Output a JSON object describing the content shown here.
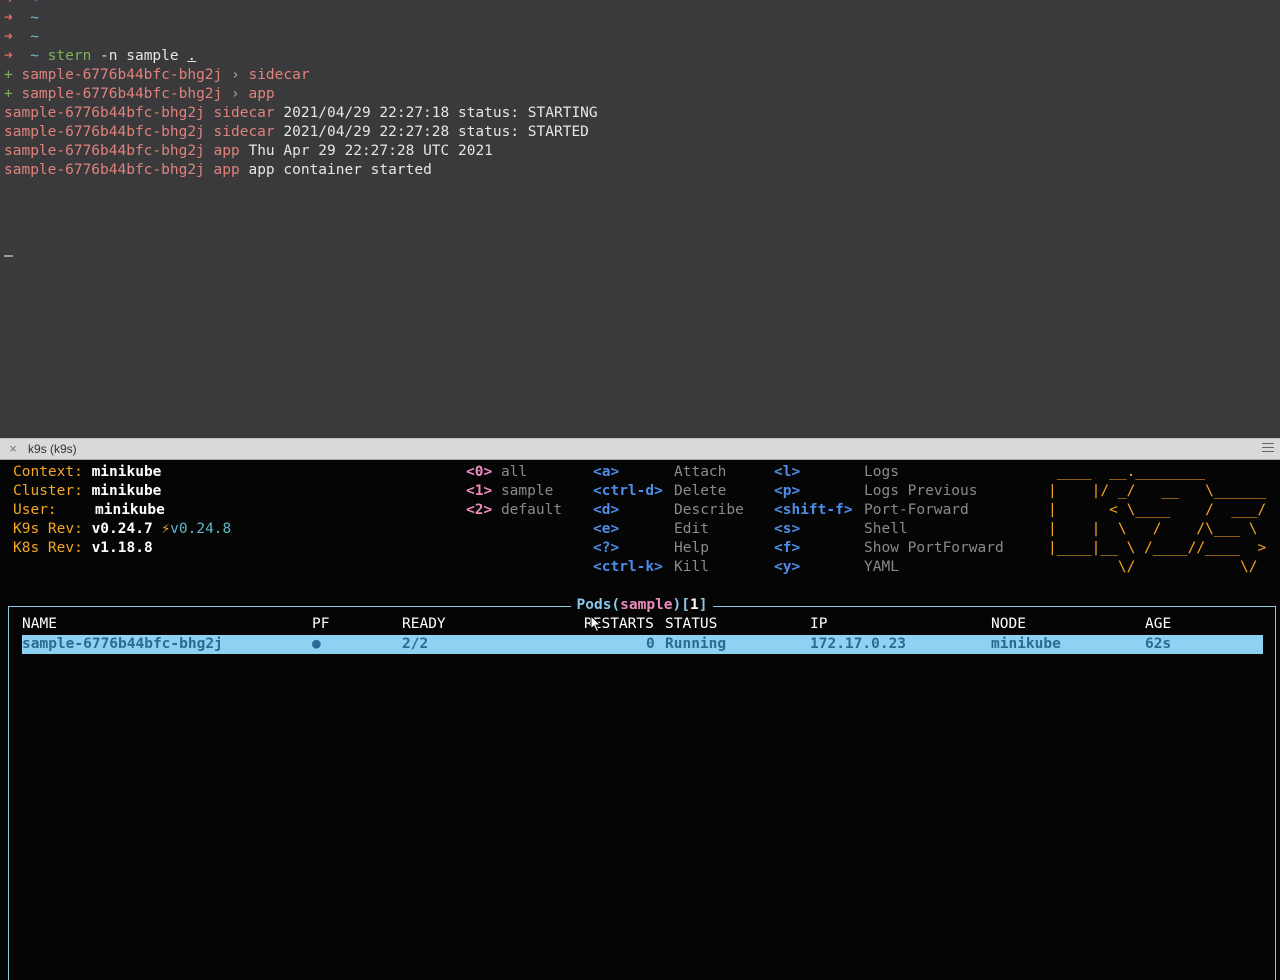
{
  "top_terminal": {
    "prompts": [
      {
        "arrow": "➜",
        "dir": "~",
        "cmd": ""
      },
      {
        "arrow": "➜",
        "dir": "~",
        "cmd": ""
      },
      {
        "arrow": "➜",
        "dir": "~",
        "cmd": ""
      }
    ],
    "command": {
      "arrow": "➜",
      "dir": "~",
      "program": "stern",
      "args": " -n sample ",
      "cursor_char": "."
    },
    "added": [
      {
        "plus": "+",
        "pod": "sample-6776b44bfc-bhg2j",
        "sep": " › ",
        "container": "sidecar"
      },
      {
        "plus": "+",
        "pod": "sample-6776b44bfc-bhg2j",
        "sep": " › ",
        "container": "app"
      }
    ],
    "logs": [
      {
        "pod": "sample-6776b44bfc-bhg2j",
        "container": "sidecar",
        "message": "2021/04/29 22:27:18 status: STARTING"
      },
      {
        "pod": "sample-6776b44bfc-bhg2j",
        "container": "sidecar",
        "message": "2021/04/29 22:27:28 status: STARTED"
      },
      {
        "pod": "sample-6776b44bfc-bhg2j",
        "container": "app",
        "message": "Thu Apr 29 22:27:28 UTC 2021"
      },
      {
        "pod": "sample-6776b44bfc-bhg2j",
        "container": "app",
        "message": "app container started"
      }
    ]
  },
  "tab": {
    "title": "k9s (k9s)",
    "close_icon": "×"
  },
  "k9s": {
    "info": [
      {
        "label": "Context:",
        "value": "minikube"
      },
      {
        "label": "Cluster:",
        "value": "minikube"
      },
      {
        "label": "User:",
        "value": "minikube"
      },
      {
        "label": "K9s Rev:",
        "value": "v0.24.7",
        "upgrade_icon": "⚡",
        "upgrade": "v0.24.8"
      },
      {
        "label": "K8s Rev:",
        "value": "v1.18.8"
      }
    ],
    "namespaces": [
      {
        "key": "<0>",
        "name": "all"
      },
      {
        "key": "<1>",
        "name": "sample"
      },
      {
        "key": "<2>",
        "name": "default"
      }
    ],
    "shortcuts_col1": [
      {
        "key": "<a>",
        "desc": "Attach"
      },
      {
        "key": "<ctrl-d>",
        "desc": "Delete"
      },
      {
        "key": "<d>",
        "desc": "Describe"
      },
      {
        "key": "<e>",
        "desc": "Edit"
      },
      {
        "key": "<?>",
        "desc": "Help"
      },
      {
        "key": "<ctrl-k>",
        "desc": "Kill"
      }
    ],
    "shortcuts_col2": [
      {
        "key": "<l>",
        "desc": "Logs"
      },
      {
        "key": "<p>",
        "desc": "Logs Previous"
      },
      {
        "key": "<shift-f>",
        "desc": "Port-Forward"
      },
      {
        "key": "<s>",
        "desc": "Shell"
      },
      {
        "key": "<f>",
        "desc": "Show PortForward"
      },
      {
        "key": "<y>",
        "desc": "YAML"
      }
    ],
    "logo_lines": [
      " ____  __.________       ",
      "|    |/ _/   __   \\______",
      "|      < \\____    /  ___/",
      "|    |  \\   /    /\\___ \\ ",
      "|____|__ \\ /____//____  >",
      "        \\/            \\/ "
    ],
    "pods": {
      "resource": "Pods",
      "namespace": "sample",
      "count": "1",
      "columns": [
        "NAME",
        "PF",
        "READY",
        "RESTARTS",
        "STATUS",
        "IP",
        "NODE",
        "AGE"
      ],
      "rows": [
        {
          "name": "sample-6776b44bfc-bhg2j",
          "pf": "●",
          "ready": "2/2",
          "restarts": "0",
          "status": "Running",
          "ip": "172.17.0.23",
          "node": "minikube",
          "age": "62s"
        }
      ]
    }
  }
}
